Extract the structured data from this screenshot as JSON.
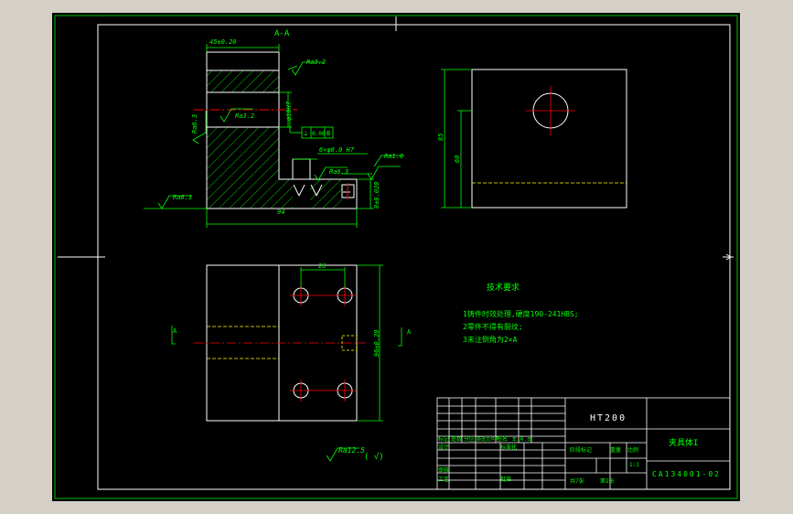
{
  "drawing": {
    "section_label": "A-A",
    "dims": {
      "top_width": "45±0.20",
      "bottom_width": "94",
      "hole_dia": "φ10H7",
      "hole_spec": "6×φ8.0 H7",
      "height_right": "8±0.020",
      "top_view_width": "26",
      "top_view_height": "96±0.20",
      "side_height": "85",
      "side_inner": "60"
    },
    "roughness": {
      "r1": "Ra3.2",
      "r2": "Ra3.2",
      "r3": "Ra6.3",
      "r4": "Ra6.3",
      "r5": "Ra6.3",
      "r6": "Ra1.6",
      "general": "Ra12.5"
    },
    "tolerance_frame": {
      "symbol": "⊥",
      "value": "0.06",
      "datum": "B"
    },
    "section_marks": {
      "left": "A",
      "right": "A"
    },
    "tech_req": {
      "title": "技术要求",
      "lines": [
        "1铸件时效处理,硬度190-241HBS;",
        "2零件不得有裂纹;",
        "3未注倒角为2×A"
      ]
    }
  },
  "title_block": {
    "material": "HT200",
    "part_name": "夹具体I",
    "drawing_no": "CA134001-02",
    "scale": "1:1",
    "sheets": "共7张",
    "sheet_no": "第2张",
    "labels": {
      "mark": "标记",
      "count": "处数",
      "zone": "分区",
      "doc_no": "更改文件号",
      "sign": "签名",
      "date": "年.月.日",
      "design": "设计",
      "standard": "标准化",
      "stage_mark": "阶段标记",
      "weight": "重量",
      "ratio": "比例",
      "review": "审核",
      "process": "工艺",
      "approve": "批准"
    }
  }
}
